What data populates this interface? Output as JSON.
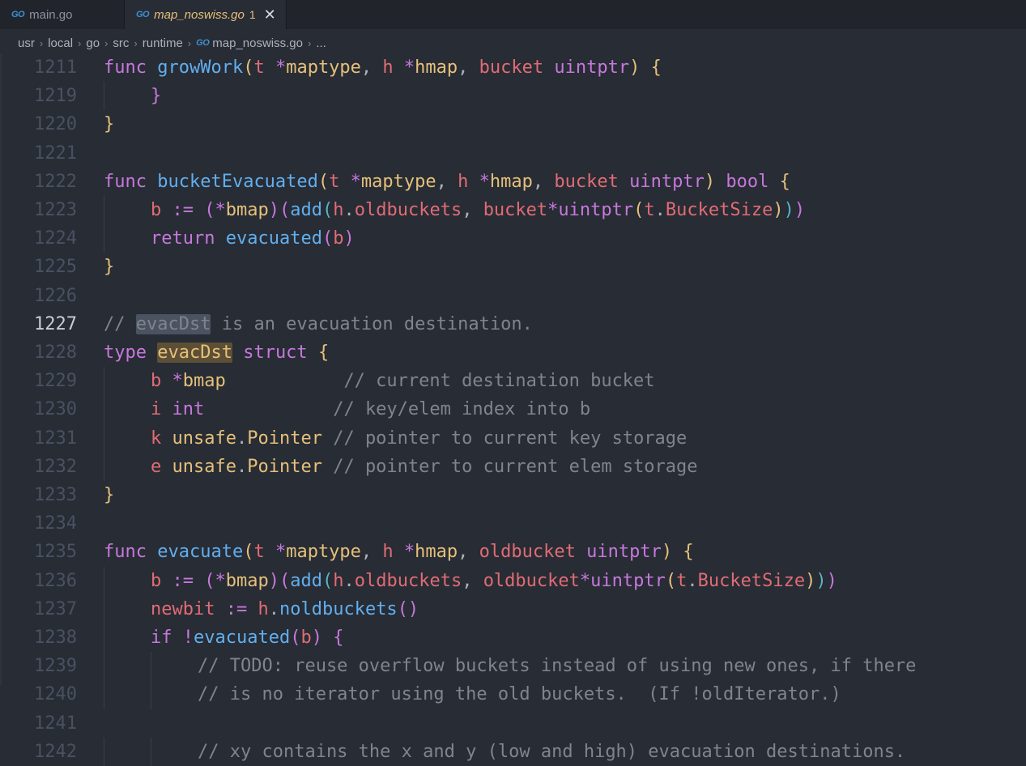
{
  "tabs": [
    {
      "title": "main.go",
      "badge": "",
      "active": false
    },
    {
      "title": "map_noswiss.go",
      "badge": "1",
      "active": true
    }
  ],
  "tab_icon_text": "GO",
  "tab_close_glyph": "✕",
  "breadcrumb": [
    "usr",
    "local",
    "go",
    "src",
    "runtime",
    "map_noswiss.go",
    "..."
  ],
  "breadcrumb_sep": "›",
  "current_line": "1227",
  "lines": [
    {
      "n": "1211",
      "indent": 0,
      "tokens": [
        [
          "k",
          "func"
        ],
        [
          "p",
          " "
        ],
        [
          "f",
          "growWork"
        ],
        [
          "b1",
          "("
        ],
        [
          "v",
          "t"
        ],
        [
          "p",
          " "
        ],
        [
          "k",
          "*"
        ],
        [
          "t",
          "maptype"
        ],
        [
          "p",
          ", "
        ],
        [
          "v",
          "h"
        ],
        [
          "p",
          " "
        ],
        [
          "k",
          "*"
        ],
        [
          "t",
          "hmap"
        ],
        [
          "p",
          ", "
        ],
        [
          "v",
          "bucket"
        ],
        [
          "p",
          " "
        ],
        [
          "k",
          "uintptr"
        ],
        [
          "b1",
          ")"
        ],
        [
          "p",
          " "
        ],
        [
          "b1",
          "{"
        ]
      ]
    },
    {
      "n": "1219",
      "indent": 1,
      "tokens": [
        [
          "b2",
          "}"
        ]
      ]
    },
    {
      "n": "1220",
      "indent": 0,
      "tokens": [
        [
          "b1",
          "}"
        ]
      ]
    },
    {
      "n": "1221",
      "indent": 0,
      "tokens": []
    },
    {
      "n": "1222",
      "indent": 0,
      "tokens": [
        [
          "k",
          "func"
        ],
        [
          "p",
          " "
        ],
        [
          "f",
          "bucketEvacuated"
        ],
        [
          "b1",
          "("
        ],
        [
          "v",
          "t"
        ],
        [
          "p",
          " "
        ],
        [
          "k",
          "*"
        ],
        [
          "t",
          "maptype"
        ],
        [
          "p",
          ", "
        ],
        [
          "v",
          "h"
        ],
        [
          "p",
          " "
        ],
        [
          "k",
          "*"
        ],
        [
          "t",
          "hmap"
        ],
        [
          "p",
          ", "
        ],
        [
          "v",
          "bucket"
        ],
        [
          "p",
          " "
        ],
        [
          "k",
          "uintptr"
        ],
        [
          "b1",
          ")"
        ],
        [
          "p",
          " "
        ],
        [
          "k",
          "bool"
        ],
        [
          "p",
          " "
        ],
        [
          "b1",
          "{"
        ]
      ]
    },
    {
      "n": "1223",
      "indent": 1,
      "tokens": [
        [
          "v",
          "b"
        ],
        [
          "p",
          " "
        ],
        [
          "k",
          ":="
        ],
        [
          "p",
          " "
        ],
        [
          "b2",
          "("
        ],
        [
          "k",
          "*"
        ],
        [
          "t",
          "bmap"
        ],
        [
          "b2",
          ")"
        ],
        [
          "b2",
          "("
        ],
        [
          "f",
          "add"
        ],
        [
          "b3",
          "("
        ],
        [
          "v",
          "h"
        ],
        [
          "p",
          "."
        ],
        [
          "v",
          "oldbuckets"
        ],
        [
          "p",
          ", "
        ],
        [
          "v",
          "bucket"
        ],
        [
          "k",
          "*"
        ],
        [
          "k",
          "uintptr"
        ],
        [
          "b1",
          "("
        ],
        [
          "v",
          "t"
        ],
        [
          "p",
          "."
        ],
        [
          "v",
          "BucketSize"
        ],
        [
          "b1",
          ")"
        ],
        [
          "b3",
          ")"
        ],
        [
          "b2",
          ")"
        ]
      ]
    },
    {
      "n": "1224",
      "indent": 1,
      "tokens": [
        [
          "k",
          "return"
        ],
        [
          "p",
          " "
        ],
        [
          "f",
          "evacuated"
        ],
        [
          "b2",
          "("
        ],
        [
          "v",
          "b"
        ],
        [
          "b2",
          ")"
        ]
      ]
    },
    {
      "n": "1225",
      "indent": 0,
      "tokens": [
        [
          "b1",
          "}"
        ]
      ]
    },
    {
      "n": "1226",
      "indent": 0,
      "tokens": []
    },
    {
      "n": "1227",
      "indent": 0,
      "tokens": [
        [
          "c",
          "// "
        ],
        [
          "c hl-ref",
          "evacDst"
        ],
        [
          "c",
          " is an evacuation destination."
        ]
      ]
    },
    {
      "n": "1228",
      "indent": 0,
      "tokens": [
        [
          "k",
          "type"
        ],
        [
          "p",
          " "
        ],
        [
          "t hl-def",
          "evacDst"
        ],
        [
          "p",
          " "
        ],
        [
          "k",
          "struct"
        ],
        [
          "p",
          " "
        ],
        [
          "b1",
          "{"
        ]
      ]
    },
    {
      "n": "1229",
      "indent": 1,
      "tokens": [
        [
          "v",
          "b"
        ],
        [
          "p",
          " "
        ],
        [
          "k",
          "*"
        ],
        [
          "t",
          "bmap"
        ],
        [
          "p",
          "           "
        ],
        [
          "c",
          "// current destination bucket"
        ]
      ]
    },
    {
      "n": "1230",
      "indent": 1,
      "tokens": [
        [
          "v",
          "i"
        ],
        [
          "p",
          " "
        ],
        [
          "k",
          "int"
        ],
        [
          "p",
          "            "
        ],
        [
          "c",
          "// key/elem index into b"
        ]
      ]
    },
    {
      "n": "1231",
      "indent": 1,
      "tokens": [
        [
          "v",
          "k"
        ],
        [
          "p",
          " "
        ],
        [
          "t",
          "unsafe"
        ],
        [
          "p",
          "."
        ],
        [
          "t",
          "Pointer"
        ],
        [
          "p",
          " "
        ],
        [
          "c",
          "// pointer to current key storage"
        ]
      ]
    },
    {
      "n": "1232",
      "indent": 1,
      "tokens": [
        [
          "v",
          "e"
        ],
        [
          "p",
          " "
        ],
        [
          "t",
          "unsafe"
        ],
        [
          "p",
          "."
        ],
        [
          "t",
          "Pointer"
        ],
        [
          "p",
          " "
        ],
        [
          "c",
          "// pointer to current elem storage"
        ]
      ]
    },
    {
      "n": "1233",
      "indent": 0,
      "tokens": [
        [
          "b1",
          "}"
        ]
      ]
    },
    {
      "n": "1234",
      "indent": 0,
      "tokens": []
    },
    {
      "n": "1235",
      "indent": 0,
      "tokens": [
        [
          "k",
          "func"
        ],
        [
          "p",
          " "
        ],
        [
          "f",
          "evacuate"
        ],
        [
          "b1",
          "("
        ],
        [
          "v",
          "t"
        ],
        [
          "p",
          " "
        ],
        [
          "k",
          "*"
        ],
        [
          "t",
          "maptype"
        ],
        [
          "p",
          ", "
        ],
        [
          "v",
          "h"
        ],
        [
          "p",
          " "
        ],
        [
          "k",
          "*"
        ],
        [
          "t",
          "hmap"
        ],
        [
          "p",
          ", "
        ],
        [
          "v",
          "oldbucket"
        ],
        [
          "p",
          " "
        ],
        [
          "k",
          "uintptr"
        ],
        [
          "b1",
          ")"
        ],
        [
          "p",
          " "
        ],
        [
          "b1",
          "{"
        ]
      ]
    },
    {
      "n": "1236",
      "indent": 1,
      "tokens": [
        [
          "v",
          "b"
        ],
        [
          "p",
          " "
        ],
        [
          "k",
          ":="
        ],
        [
          "p",
          " "
        ],
        [
          "b2",
          "("
        ],
        [
          "k",
          "*"
        ],
        [
          "t",
          "bmap"
        ],
        [
          "b2",
          ")"
        ],
        [
          "b2",
          "("
        ],
        [
          "f",
          "add"
        ],
        [
          "b3",
          "("
        ],
        [
          "v",
          "h"
        ],
        [
          "p",
          "."
        ],
        [
          "v",
          "oldbuckets"
        ],
        [
          "p",
          ", "
        ],
        [
          "v",
          "oldbucket"
        ],
        [
          "k",
          "*"
        ],
        [
          "k",
          "uintptr"
        ],
        [
          "b1",
          "("
        ],
        [
          "v",
          "t"
        ],
        [
          "p",
          "."
        ],
        [
          "v",
          "BucketSize"
        ],
        [
          "b1",
          ")"
        ],
        [
          "b3",
          ")"
        ],
        [
          "b2",
          ")"
        ]
      ]
    },
    {
      "n": "1237",
      "indent": 1,
      "tokens": [
        [
          "v",
          "newbit"
        ],
        [
          "p",
          " "
        ],
        [
          "k",
          ":="
        ],
        [
          "p",
          " "
        ],
        [
          "v",
          "h"
        ],
        [
          "p",
          "."
        ],
        [
          "f",
          "noldbuckets"
        ],
        [
          "b2",
          "()"
        ]
      ]
    },
    {
      "n": "1238",
      "indent": 1,
      "tokens": [
        [
          "k",
          "if"
        ],
        [
          "p",
          " "
        ],
        [
          "k",
          "!"
        ],
        [
          "f",
          "evacuated"
        ],
        [
          "b2",
          "("
        ],
        [
          "v",
          "b"
        ],
        [
          "b2",
          ")"
        ],
        [
          "p",
          " "
        ],
        [
          "b2",
          "{"
        ]
      ]
    },
    {
      "n": "1239",
      "indent": 2,
      "tokens": [
        [
          "c",
          "// TODO: reuse overflow buckets instead of using new ones, if there"
        ]
      ]
    },
    {
      "n": "1240",
      "indent": 2,
      "tokens": [
        [
          "c",
          "// is no iterator using the old buckets.  (If !oldIterator.)"
        ]
      ]
    },
    {
      "n": "1241",
      "indent": 0,
      "tokens": []
    },
    {
      "n": "1242",
      "indent": 2,
      "tokens": [
        [
          "c",
          "// xy contains the x and y (low and high) evacuation destinations."
        ]
      ]
    }
  ]
}
